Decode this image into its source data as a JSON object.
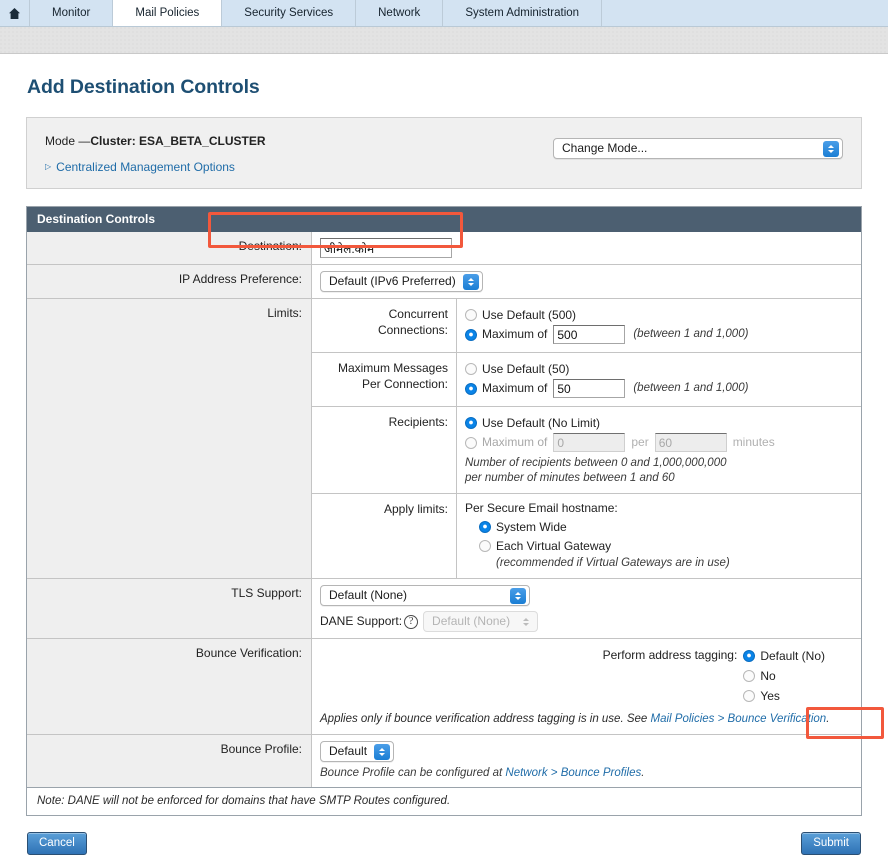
{
  "nav": {
    "home_icon": "home-icon",
    "tabs": [
      {
        "label": "Monitor",
        "active": false
      },
      {
        "label": "Mail Policies",
        "active": true
      },
      {
        "label": "Security Services",
        "active": false
      },
      {
        "label": "Network",
        "active": false
      },
      {
        "label": "System Administration",
        "active": false
      }
    ]
  },
  "page": {
    "title": "Add Destination Controls"
  },
  "mode_panel": {
    "mode_prefix": "Mode —",
    "mode_value": "Cluster: ESA_BETA_CLUSTER",
    "centralized_management_options": "Centralized Management Options",
    "change_mode_select": "Change Mode..."
  },
  "form": {
    "section_title": "Destination Controls",
    "destination": {
      "label": "Destination:",
      "value": "जीमेल.कोम",
      "placeholder": ""
    },
    "ip_address_preference": {
      "label": "IP Address Preference:",
      "value": "Default (IPv6 Preferred)"
    },
    "limits": {
      "label": "Limits:",
      "concurrent_connections": {
        "label": "Concurrent Connections:",
        "use_default_label": "Use Default (500)",
        "use_default_selected": false,
        "maximum_label": "Maximum of",
        "maximum_selected": true,
        "maximum_value": "500",
        "range_hint": "(between 1 and 1,000)"
      },
      "max_messages_per_connection": {
        "label": "Maximum Messages Per Connection:",
        "use_default_label": "Use Default (50)",
        "use_default_selected": false,
        "maximum_label": "Maximum of",
        "maximum_selected": true,
        "maximum_value": "50",
        "range_hint": "(between 1 and 1,000)"
      },
      "recipients": {
        "label": "Recipients:",
        "use_default_label": "Use Default (No Limit)",
        "use_default_selected": true,
        "maximum_label": "Maximum of",
        "maximum_selected": false,
        "maximum_value": "0",
        "per_label": "per",
        "minutes_value": "60",
        "minutes_label": "minutes",
        "hint_line1": "Number of recipients between 0 and 1,000,000,000",
        "hint_line2": "per number of minutes between 1 and 60"
      },
      "apply_limits": {
        "label": "Apply limits:",
        "caption": "Per Secure Email hostname:",
        "option_system_wide": "System Wide",
        "system_wide_selected": true,
        "option_each_virtual_gateway": "Each Virtual Gateway",
        "each_virtual_gateway_selected": false,
        "hint": "(recommended if Virtual Gateways are in use)"
      }
    },
    "tls_support": {
      "label": "TLS Support:",
      "value": "Default (None)",
      "dane_label": "DANE Support:",
      "dane_help_icon": "question-mark-icon",
      "dane_value": "Default (None)",
      "dane_disabled": true
    },
    "bounce_verification": {
      "label": "Bounce Verification:",
      "caption": "Perform address tagging:",
      "options": [
        {
          "label": "Default (No)",
          "selected": true
        },
        {
          "label": "No",
          "selected": false
        },
        {
          "label": "Yes",
          "selected": false
        }
      ],
      "footnote_prefix": "Applies only if bounce verification address tagging is in use. See ",
      "footnote_link": "Mail Policies > Bounce Verification",
      "footnote_suffix": "."
    },
    "bounce_profile": {
      "label": "Bounce Profile:",
      "value": "Default",
      "footnote_prefix": "Bounce Profile can be configured at ",
      "footnote_link": "Network > Bounce Profiles",
      "footnote_suffix": "."
    },
    "note": "Note: DANE will not be enforced for domains that have SMTP Routes configured."
  },
  "footer": {
    "cancel_label": "Cancel",
    "submit_label": "Submit"
  },
  "colors": {
    "accent_link": "#1f6ca8",
    "section_header_bg": "#4c5f71",
    "highlight": "#f2583c",
    "nav_bg": "#d3e3f2",
    "button_blue": "#2f72b5"
  }
}
